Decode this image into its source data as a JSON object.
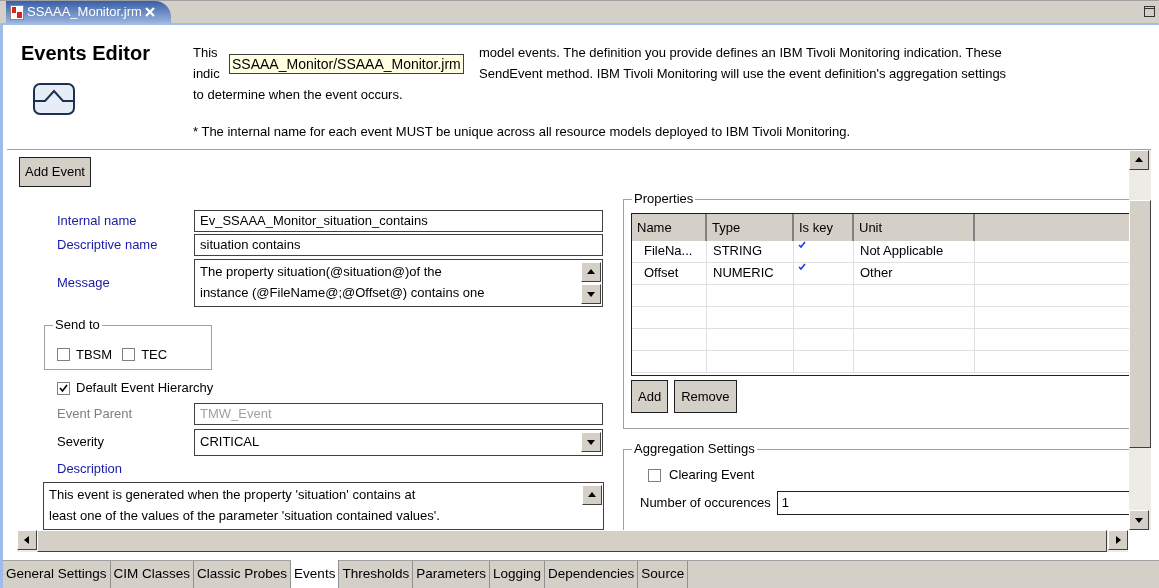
{
  "editor_tab": {
    "title": "SSAAA_Monitor.jrm",
    "selected": true
  },
  "header": {
    "title": "Events Editor",
    "intro_lines": [
      "This",
      "model events. The definition you provide defines an IBM Tivoli Monitoring indication. These",
      "indic",
      "SendEvent method. IBM Tivoli Monitoring will use the event definition's aggregation settings",
      "to determine when the event occurs."
    ],
    "note": "* The internal name for each event MUST be unique across all resource models deployed to IBM Tivoli Monitoring."
  },
  "tooltip": "SSAAA_Monitor/SSAAA_Monitor.jrm",
  "add_event_button": "Add Event",
  "fields": [
    {
      "kind": "text",
      "label": "Internal name",
      "required": true,
      "disabled": false,
      "value": "Ev_SSAAA_Monitor_situation_contains"
    },
    {
      "kind": "text",
      "label": "Descriptive name",
      "required": true,
      "disabled": false,
      "value": "situation contains"
    },
    {
      "kind": "textarea",
      "label": "Message",
      "required": true,
      "disabled": false,
      "lines": [
        "The property situation(@situation@)of the",
        "instance (@FileName@;@Offset@) contains one"
      ]
    }
  ],
  "send_to": {
    "title": "Send to",
    "options": [
      {
        "label": "TBSM",
        "checked": false
      },
      {
        "label": "TEC",
        "checked": false
      }
    ]
  },
  "default_event_hierarchy": {
    "label": "Default Event Hierarchy",
    "checked": true
  },
  "fields2": [
    {
      "kind": "text",
      "label": "Event Parent",
      "required": false,
      "disabled": true,
      "value": "TMW_Event"
    },
    {
      "kind": "combo",
      "label": "Severity",
      "required": false,
      "disabled": false,
      "value": "CRITICAL"
    }
  ],
  "description": {
    "label": "Description",
    "lines": [
      "This event is generated when the property 'situation' contains at",
      "least one of the values of the parameter 'situation contained values'."
    ]
  },
  "properties": {
    "title": "Properties",
    "columns": [
      "Name",
      "Type",
      "Is key",
      "Unit"
    ],
    "rows": [
      {
        "name": "FileNa...",
        "type": "STRING",
        "is_key": true,
        "unit": "Not Applicable"
      },
      {
        "name": "Offset",
        "type": "NUMERIC",
        "is_key": true,
        "unit": "Other"
      }
    ],
    "buttons": [
      "Add",
      "Remove"
    ]
  },
  "aggregation": {
    "title": "Aggregation Settings",
    "clearing_event": {
      "label": "Clearing Event",
      "checked": false
    },
    "occurrences": {
      "label": "Number of occurences",
      "value": "1"
    }
  },
  "bottom_tabs": [
    {
      "label": "General Settings",
      "selected": false
    },
    {
      "label": "CIM Classes",
      "selected": false
    },
    {
      "label": "Classic Probes",
      "selected": false
    },
    {
      "label": "Events",
      "selected": true
    },
    {
      "label": "Thresholds",
      "selected": false
    },
    {
      "label": "Parameters",
      "selected": false
    },
    {
      "label": "Logging",
      "selected": false
    },
    {
      "label": "Dependencies",
      "selected": false
    },
    {
      "label": "Source",
      "selected": false
    }
  ]
}
